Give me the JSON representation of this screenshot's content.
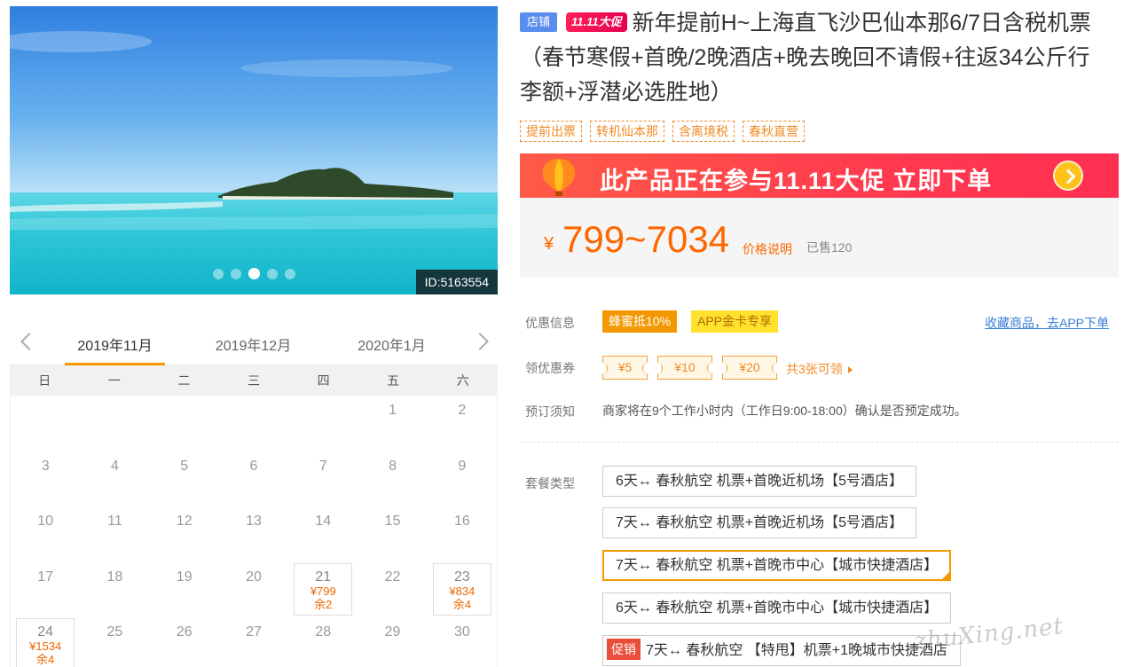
{
  "gallery": {
    "image_id": "ID:5163554",
    "slide_count": 5,
    "active_slide": 2
  },
  "calendar": {
    "months": [
      "2019年11月",
      "2019年12月",
      "2020年1月"
    ],
    "active_month": 0,
    "weekdays": [
      "日",
      "一",
      "二",
      "三",
      "四",
      "五",
      "六"
    ],
    "weeks": [
      [
        {
          "day": ""
        },
        {
          "day": ""
        },
        {
          "day": ""
        },
        {
          "day": ""
        },
        {
          "day": ""
        },
        {
          "day": "1"
        },
        {
          "day": "2"
        }
      ],
      [
        {
          "day": "3"
        },
        {
          "day": "4"
        },
        {
          "day": "5"
        },
        {
          "day": "6"
        },
        {
          "day": "7"
        },
        {
          "day": "8"
        },
        {
          "day": "9"
        }
      ],
      [
        {
          "day": "10"
        },
        {
          "day": "11"
        },
        {
          "day": "12"
        },
        {
          "day": "13"
        },
        {
          "day": "14"
        },
        {
          "day": "15"
        },
        {
          "day": "16"
        }
      ],
      [
        {
          "day": "17"
        },
        {
          "day": "18"
        },
        {
          "day": "19"
        },
        {
          "day": "20"
        },
        {
          "day": "21",
          "price": "¥799",
          "stock": "余2"
        },
        {
          "day": "22"
        },
        {
          "day": "23",
          "price": "¥834",
          "stock": "余4"
        }
      ],
      [
        {
          "day": "24",
          "price": "¥1534",
          "stock": "余4"
        },
        {
          "day": "25"
        },
        {
          "day": "26"
        },
        {
          "day": "27"
        },
        {
          "day": "28"
        },
        {
          "day": "29"
        },
        {
          "day": "30"
        }
      ]
    ]
  },
  "product": {
    "shop_badge": "店铺",
    "promo_badge": "11.11大促",
    "title": "新年提前H~上海直飞沙巴仙本那6/7日含税机票（春节寒假+首晚/2晚酒店+晚去晚回不请假+往返34公斤行李额+浮潜必选胜地）",
    "tags": [
      "提前出票",
      "转机仙本那",
      "含离境税",
      "春秋直营"
    ]
  },
  "banner": {
    "text": "此产品正在参与11.11大促 立即下单"
  },
  "price": {
    "currency": "¥",
    "range": "799~7034",
    "note": "价格说明",
    "sold": "已售120"
  },
  "offers": {
    "label": "优惠信息",
    "discount": "蜂蜜抵10%",
    "app": "APP金卡专享",
    "fav_link": "收藏商品，去APP下单"
  },
  "coupons": {
    "label": "领优惠券",
    "items": [
      "¥5",
      "¥10",
      "¥20"
    ],
    "more": "共3张可领"
  },
  "booking": {
    "label": "预订须知",
    "text": "商家将在9个工作小时内（工作日9:00-18:00）确认是否预定成功。"
  },
  "packages": {
    "label": "套餐类型",
    "selected_index": 2,
    "items": [
      {
        "label": "6天↔ 春秋航空 机票+首晚近机场【5号酒店】"
      },
      {
        "label": "7天↔ 春秋航空 机票+首晚近机场【5号酒店】"
      },
      {
        "label": "7天↔ 春秋航空 机票+首晚市中心【城市快捷酒店】"
      },
      {
        "label": "6天↔ 春秋航空 机票+首晚市中心【城市快捷酒店】"
      },
      {
        "label": "7天↔ 春秋航空 【特甩】机票+1晚城市快捷酒店",
        "promo": "促销"
      }
    ]
  },
  "watermark": "zhuXing.net",
  "colors": {
    "accent": "#f39800",
    "price": "#ff6600",
    "banner": "#ff3a4f",
    "link": "#3a7dd8"
  }
}
